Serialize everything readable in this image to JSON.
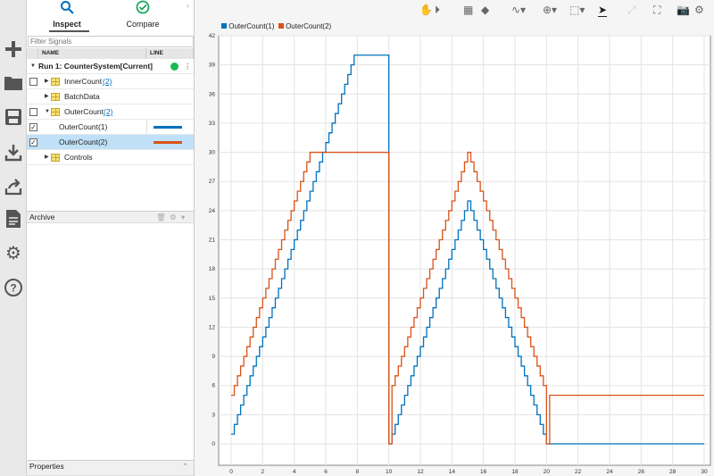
{
  "sidebar_icons": [
    "add-icon",
    "folder-icon",
    "save-icon",
    "download-icon",
    "share-icon",
    "document-icon",
    "gear-icon",
    "help-icon"
  ],
  "tabs": {
    "inspect": "Inspect",
    "compare": "Compare"
  },
  "filter_placeholder": "Filter Signals",
  "columns": {
    "name": "NAME",
    "line": "LINE"
  },
  "run": {
    "label": "Run 1: CounterSystem[Current]",
    "status_color": "#1db954"
  },
  "signals": [
    {
      "label": "InnerCount",
      "count": "(2)"
    },
    {
      "label": "BatchData"
    },
    {
      "label": "OuterCount",
      "count": "(2)"
    },
    {
      "label": "OuterCount(1)",
      "color": "#0072bd",
      "checked": true
    },
    {
      "label": "OuterCount(2)",
      "color": "#d95319",
      "checked": true
    },
    {
      "label": "Controls"
    }
  ],
  "archive_label": "Archive",
  "properties_label": "Properties",
  "toolbar": [
    "pan-icon",
    "play-icon",
    "layout-icon",
    "eraser-icon",
    "signal-icon",
    "zoom-icon",
    "fit-icon",
    "cursor-icon",
    "expand-icon",
    "fullscreen-icon",
    "camera-icon",
    "settings-icon"
  ],
  "chart_data": {
    "type": "line",
    "title": "",
    "xlabel": "",
    "ylabel": "",
    "xlim": [
      0,
      30
    ],
    "ylim": [
      0,
      42
    ],
    "xticks": [
      0,
      2,
      4,
      6,
      8,
      10,
      12,
      14,
      16,
      18,
      20,
      22,
      24,
      26,
      28,
      30
    ],
    "yticks": [
      0,
      3,
      6,
      9,
      12,
      15,
      18,
      21,
      24,
      27,
      30,
      33,
      36,
      39,
      42
    ],
    "grid": true,
    "legend": "top-left",
    "step": 0.2,
    "series": [
      {
        "name": "OuterCount(1)",
        "color": "#0072bd",
        "final_value": 0,
        "values": [
          1,
          2,
          3,
          4,
          5,
          6,
          7,
          8,
          9,
          10,
          11,
          12,
          13,
          14,
          15,
          16,
          17,
          18,
          19,
          20,
          21,
          22,
          23,
          24,
          25,
          26,
          27,
          28,
          29,
          30,
          31,
          32,
          33,
          34,
          35,
          36,
          37,
          38,
          39,
          40,
          40,
          40,
          40,
          40,
          40,
          40,
          40,
          40,
          40,
          40,
          0,
          1,
          2,
          3,
          4,
          5,
          6,
          7,
          8,
          9,
          10,
          11,
          12,
          13,
          14,
          15,
          16,
          17,
          18,
          19,
          20,
          21,
          22,
          23,
          24,
          25,
          24,
          23,
          22,
          21,
          20,
          19,
          18,
          17,
          16,
          15,
          14,
          13,
          12,
          11,
          10,
          9,
          8,
          7,
          6,
          5,
          4,
          3,
          2,
          1,
          0
        ]
      },
      {
        "name": "OuterCount(2)",
        "color": "#d95319",
        "final_value": 5,
        "values": [
          5,
          6,
          7,
          8,
          9,
          10,
          11,
          12,
          13,
          14,
          15,
          16,
          17,
          18,
          19,
          20,
          21,
          22,
          23,
          24,
          25,
          26,
          27,
          28,
          29,
          30,
          30,
          30,
          30,
          30,
          30,
          30,
          30,
          30,
          30,
          30,
          30,
          30,
          30,
          30,
          30,
          30,
          30,
          30,
          30,
          30,
          30,
          30,
          30,
          30,
          0,
          6,
          7,
          8,
          9,
          10,
          11,
          12,
          13,
          14,
          15,
          16,
          17,
          18,
          19,
          20,
          21,
          22,
          23,
          24,
          25,
          26,
          27,
          28,
          29,
          30,
          29,
          28,
          27,
          26,
          25,
          24,
          23,
          22,
          21,
          20,
          19,
          18,
          17,
          16,
          15,
          14,
          13,
          12,
          11,
          10,
          9,
          8,
          7,
          6,
          0
        ]
      }
    ]
  }
}
